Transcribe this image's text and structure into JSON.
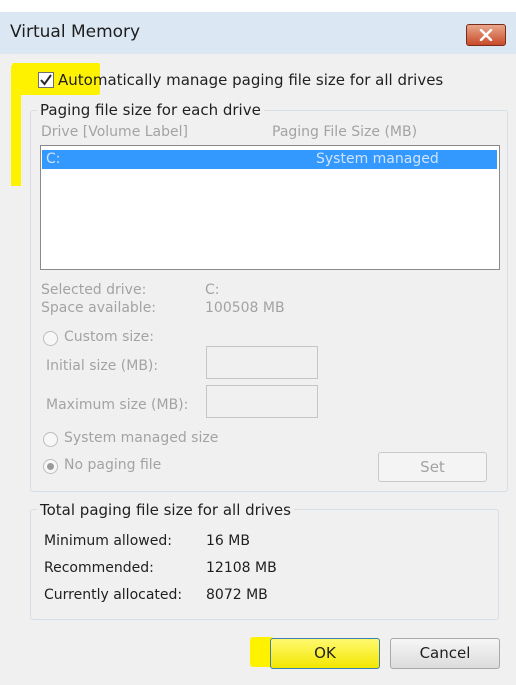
{
  "window": {
    "title": "Virtual Memory"
  },
  "auto_manage": {
    "label": "Automatically manage paging file size for all drives",
    "checked": true
  },
  "per_drive": {
    "group_label": "Paging file size for each drive",
    "columns": [
      "Drive  [Volume Label]",
      "Paging File Size (MB)"
    ],
    "rows": [
      {
        "drive": "C:",
        "size": "System managed"
      }
    ],
    "selected_drive_label": "Selected drive:",
    "selected_drive_value": "C:",
    "space_available_label": "Space available:",
    "space_available_value": "100508 MB",
    "custom_size_label": "Custom size:",
    "initial_size_label": "Initial size (MB):",
    "initial_size_value": "",
    "maximum_size_label": "Maximum size (MB):",
    "maximum_size_value": "",
    "system_managed_label": "System managed size",
    "no_paging_label": "No paging file",
    "set_label": "Set"
  },
  "totals": {
    "group_label": "Total paging file size for all drives",
    "minimum_label": "Minimum allowed:",
    "minimum_value": "16 MB",
    "recommended_label": "Recommended:",
    "recommended_value": "12108 MB",
    "allocated_label": "Currently allocated:",
    "allocated_value": "8072 MB"
  },
  "buttons": {
    "ok": "OK",
    "cancel": "Cancel"
  },
  "colors": {
    "highlight": "#fff200",
    "selection": "#3399ff",
    "close": "#c84b2a"
  }
}
